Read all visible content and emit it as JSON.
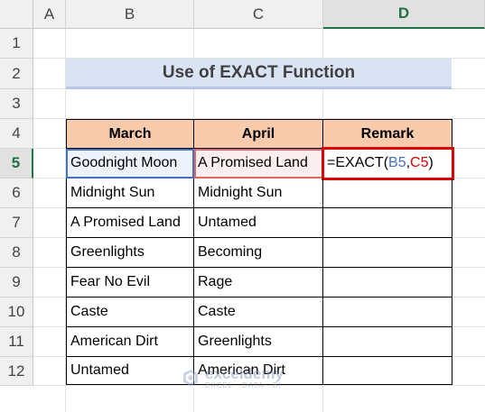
{
  "columns": [
    "A",
    "B",
    "C",
    "D"
  ],
  "selected_column": "D",
  "rows": [
    "1",
    "2",
    "3",
    "4",
    "5",
    "6",
    "7",
    "8",
    "9",
    "10",
    "11",
    "12"
  ],
  "selected_row": "5",
  "title": "Use of EXACT Function",
  "table": {
    "headers": [
      "March",
      "April",
      "Remark"
    ],
    "rows": [
      [
        "Goodnight Moon",
        "A Promised Land"
      ],
      [
        "Midnight Sun",
        "Midnight Sun"
      ],
      [
        "A Promised Land",
        "Untamed"
      ],
      [
        "Greenlights",
        "Becoming"
      ],
      [
        "Fear No Evil",
        "Rage"
      ],
      [
        "Caste",
        "Caste"
      ],
      [
        "American Dirt",
        "Greenlights"
      ],
      [
        "Untamed",
        "American Dirt"
      ]
    ]
  },
  "formula": {
    "prefix": "=EXACT(",
    "ref1": "B5",
    "sep": ",",
    "ref2": "C5",
    "suffix": ")"
  },
  "colors": {
    "ref1": "#4472c4",
    "ref2": "#e00000",
    "header_fill": "#f8cbad",
    "title_fill": "#dae3f3",
    "select_green": "#217346"
  },
  "watermark": {
    "name": "exceldemy",
    "tag": "EXCEL · DATA · BI"
  }
}
